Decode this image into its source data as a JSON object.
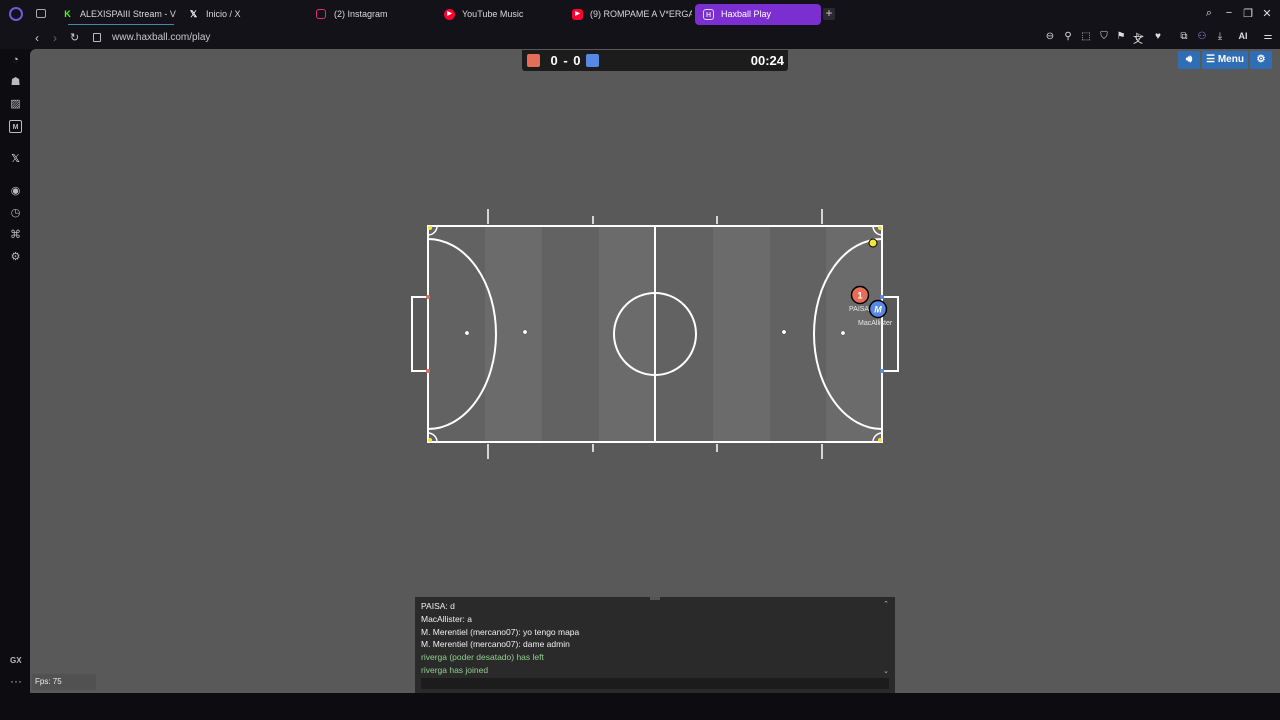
{
  "tabs": [
    {
      "label": "ALEXISPAIII Stream - V",
      "icon": "kick-icon",
      "muted": true
    },
    {
      "label": "Inicio / X",
      "icon": "x-icon"
    },
    {
      "label": "(2) Instagram",
      "icon": "instagram-icon"
    },
    {
      "label": "YouTube Music",
      "icon": "youtube-music-icon"
    },
    {
      "label": "(9) ROMPAME A V*ERGA ",
      "icon": "youtube-icon"
    },
    {
      "label": "Haxball Play",
      "icon": "haxball-icon",
      "muted": true,
      "active": true
    }
  ],
  "address": {
    "url": "www.haxball.com/play"
  },
  "toolbar": {
    "ai_label": "AI"
  },
  "game": {
    "score_red": 0,
    "score_blue": 0,
    "score_text": "0 - 0",
    "timer": "00:24",
    "menu_label": "Menu",
    "colors": {
      "red": "#e56e56",
      "blue": "#5689e5",
      "ball": "#f4e33a",
      "field": "#6b6b6b",
      "background": "#595959"
    },
    "players": [
      {
        "name": "PAISA",
        "avatar": "1",
        "team": "red"
      },
      {
        "name": "MacAllister",
        "avatar": "M",
        "team": "blue"
      }
    ]
  },
  "chat": {
    "messages": [
      {
        "text": "PAISA: d",
        "system": false
      },
      {
        "text": "MacAllister: a",
        "system": false
      },
      {
        "text": "M. Merentiel (mercano07): yo tengo mapa",
        "system": false
      },
      {
        "text": "M. Merentiel (mercano07): dame admin",
        "system": false
      },
      {
        "text": "riverga (poder desatado) has left",
        "system": true
      },
      {
        "text": "riverga has joined",
        "system": true
      }
    ],
    "input_placeholder": ""
  },
  "fps": "Fps: 75"
}
